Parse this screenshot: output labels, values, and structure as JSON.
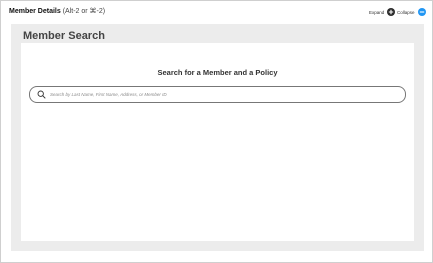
{
  "header": {
    "title": "Member Details",
    "shortcut_hint": "(Alt-2 or ⌘-2)",
    "expand_label": "Expand",
    "collapse_label": "Collapse",
    "expand_icon": "plus-circle-icon",
    "collapse_icon": "minus-circle-icon"
  },
  "panel": {
    "title": "Member Search"
  },
  "search": {
    "heading": "Search for a Member and a Policy",
    "placeholder": "Search by Last Name, First Name, Address, or Member ID",
    "value": "",
    "icon": "search-icon"
  },
  "colors": {
    "accent": "#2196f3",
    "expand_dot": "#2b2b2b",
    "panel_bg": "#ececec"
  }
}
